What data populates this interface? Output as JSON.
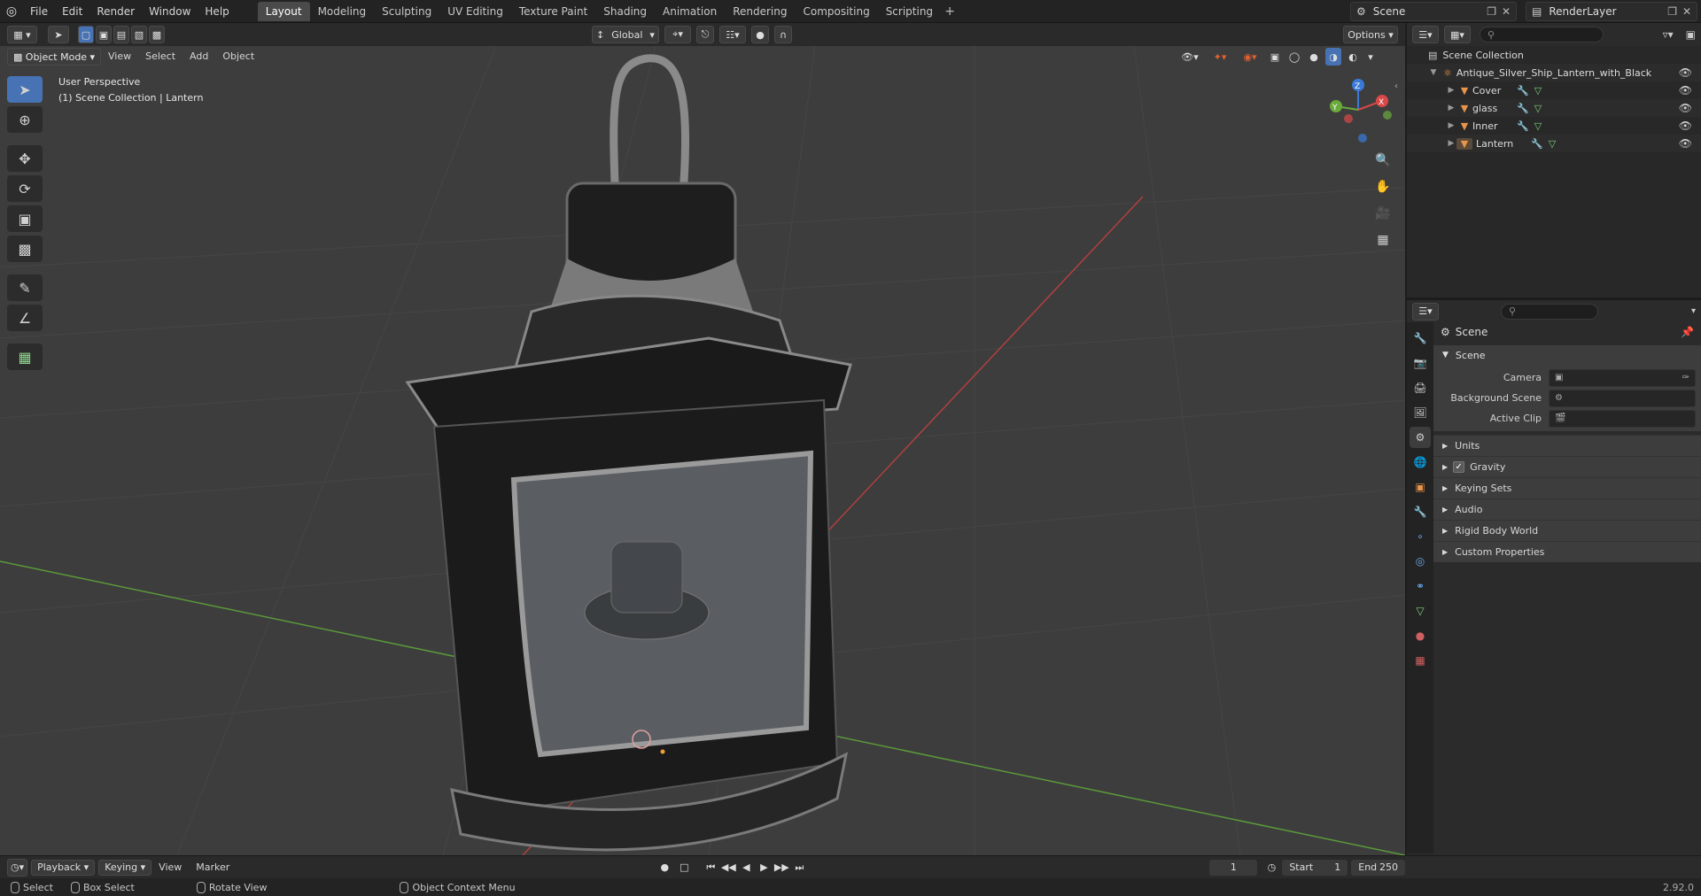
{
  "topbar": {
    "menus": [
      "File",
      "Edit",
      "Render",
      "Window",
      "Help"
    ],
    "workspaces": [
      "Layout",
      "Modeling",
      "Sculpting",
      "UV Editing",
      "Texture Paint",
      "Shading",
      "Animation",
      "Rendering",
      "Compositing",
      "Scripting"
    ],
    "active_workspace": "Layout",
    "scene_name": "Scene",
    "render_layer": "RenderLayer"
  },
  "viewport_header": {
    "mode": "Object Mode",
    "menus": [
      "View",
      "Select",
      "Add",
      "Object"
    ],
    "transform_orientation": "Global",
    "options_label": "Options"
  },
  "viewport": {
    "perspective_label": "User Perspective",
    "collection_label": "(1) Scene Collection | Lantern",
    "colors": {
      "background": "#3d3d3d",
      "x_axis": "#b04040",
      "y_axis": "#5a9a3a"
    }
  },
  "outliner": {
    "root": "Scene Collection",
    "collection": "Antique_Silver_Ship_Lantern_with_Black_Gl",
    "objects": [
      "Cover",
      "glass",
      "Inner",
      "Lantern"
    ]
  },
  "properties": {
    "context_title": "Scene",
    "panel": "Scene",
    "fields": [
      {
        "label": "Camera"
      },
      {
        "label": "Background Scene"
      },
      {
        "label": "Active Clip"
      }
    ],
    "subpanels": [
      "Units",
      "Gravity",
      "Keying Sets",
      "Audio",
      "Rigid Body World",
      "Custom Properties"
    ],
    "gravity_checked": true
  },
  "timeline": {
    "playback": "Playback",
    "keying": "Keying",
    "menus": [
      "View",
      "Marker"
    ],
    "current_frame": "1",
    "start_label": "Start",
    "start_value": "1",
    "end_label": "End",
    "end_value": "250"
  },
  "statusbar": {
    "select": "Select",
    "box_select": "Box Select",
    "rotate_view": "Rotate View",
    "context_menu": "Object Context Menu",
    "version": "2.92.0"
  }
}
